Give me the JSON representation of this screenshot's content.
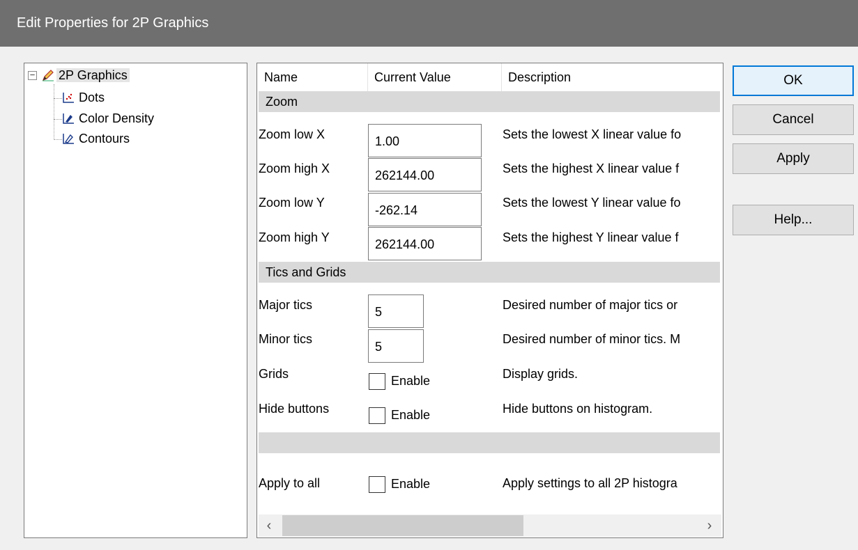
{
  "window": {
    "title": "Edit Properties for 2P Graphics"
  },
  "tree": {
    "root": {
      "label": "2P Graphics",
      "expanded_symbol": "−",
      "icon": "graphics-pencil-icon"
    },
    "children": [
      {
        "label": "Dots",
        "icon": "dot-plot-icon"
      },
      {
        "label": "Color Density",
        "icon": "density-plot-icon"
      },
      {
        "label": "Contours",
        "icon": "contour-plot-icon"
      }
    ]
  },
  "grid": {
    "columns": {
      "name": "Name",
      "value": "Current Value",
      "description": "Description"
    },
    "sections": {
      "zoom": "Zoom",
      "tics": "Tics and Grids",
      "blank": ""
    },
    "zoom_rows": [
      {
        "name": "Zoom low X",
        "value": "1.00",
        "description": "Sets the lowest X linear value fo"
      },
      {
        "name": "Zoom high X",
        "value": "262144.00",
        "description": "Sets the highest X linear value f"
      },
      {
        "name": "Zoom low Y",
        "value": "-262.14",
        "description": "Sets the lowest Y linear value fo"
      },
      {
        "name": "Zoom high Y",
        "value": "262144.00",
        "description": "Sets the highest Y linear value f"
      }
    ],
    "tic_rows": [
      {
        "name": "Major tics",
        "value": "5",
        "description": "Desired number of major tics or"
      },
      {
        "name": "Minor tics",
        "value": "5",
        "description": "Desired number of minor tics. M"
      }
    ],
    "check_rows": [
      {
        "name": "Grids",
        "check_label": "Enable",
        "checked": false,
        "description": "Display grids."
      },
      {
        "name": "Hide buttons",
        "check_label": "Enable",
        "checked": false,
        "description": "Hide buttons on histogram."
      }
    ],
    "apply_all": {
      "name": "Apply to all",
      "check_label": "Enable",
      "checked": false,
      "description": "Apply settings to all 2P histogra"
    },
    "scrollbar": {
      "left_arrow": "‹",
      "right_arrow": "›"
    }
  },
  "buttons": {
    "ok": "OK",
    "cancel": "Cancel",
    "apply": "Apply",
    "help": "Help..."
  },
  "colors": {
    "titlebar": "#6f6f6f",
    "section_band": "#d9d9d9",
    "default_button_border": "#0078d7"
  }
}
